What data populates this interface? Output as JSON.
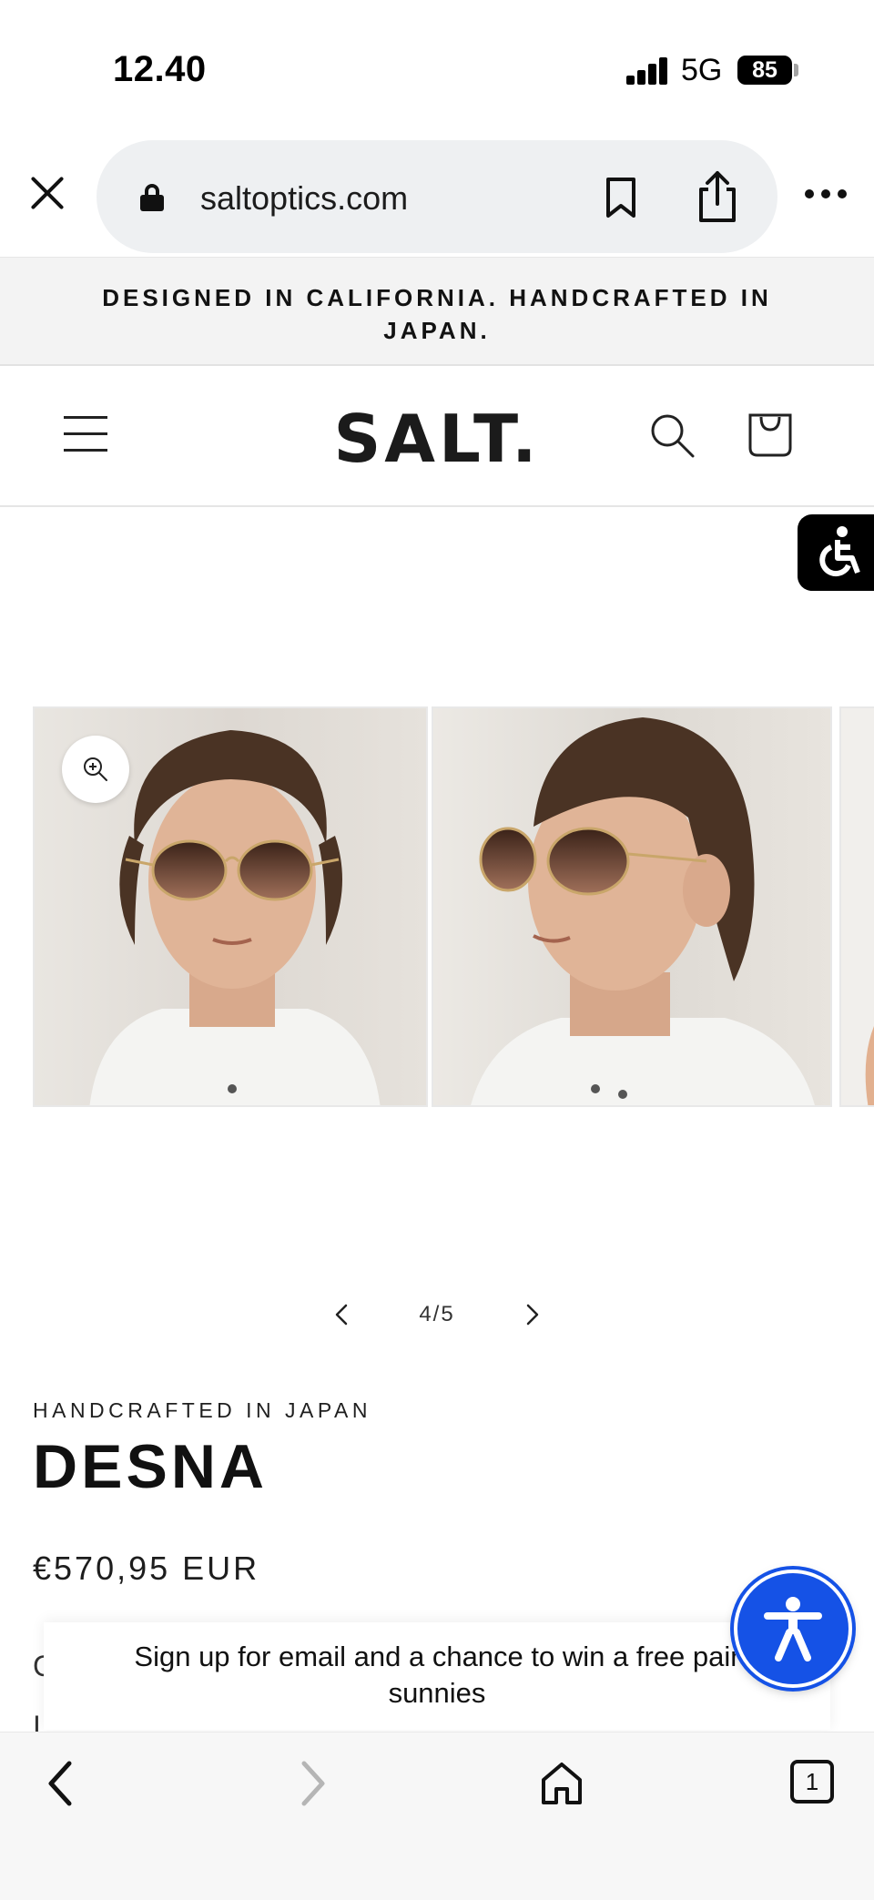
{
  "status_bar": {
    "time": "12.40",
    "network": "5G",
    "battery": "85"
  },
  "browser": {
    "url": "saltoptics.com"
  },
  "announcement": {
    "text": "DESIGNED IN CALIFORNIA. HANDCRAFTED IN JAPAN."
  },
  "header": {
    "logo": "SALT."
  },
  "gallery": {
    "counter": "4/5"
  },
  "product": {
    "subtitle": "HANDCRAFTED IN JAPAN",
    "title": "DESNA",
    "price": "€570,95 EUR",
    "partial_line_1": "C",
    "partial_line_2": "I"
  },
  "signup": {
    "text": "Sign up for email and a chance to win a free pair sunnies"
  },
  "tabs": {
    "count": "1"
  },
  "colors": {
    "accessibility_blue": "#1552e6",
    "announcement_bg": "#f3f3f3"
  },
  "icons": [
    "close-icon",
    "lock-icon",
    "bookmark-icon",
    "share-icon",
    "more-icon",
    "menu-icon",
    "search-icon",
    "cart-icon",
    "accessibility-icon",
    "zoom-icon",
    "chevron-left-icon",
    "chevron-right-icon",
    "home-icon",
    "tabs-icon"
  ]
}
